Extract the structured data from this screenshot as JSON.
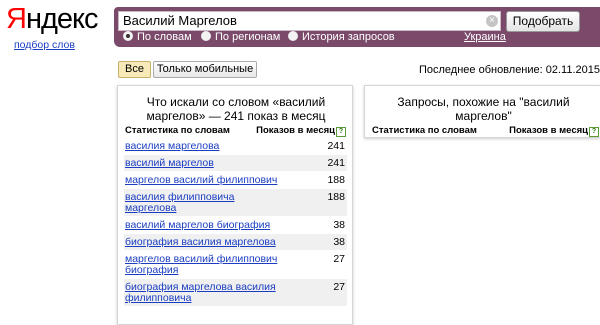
{
  "logo": {
    "first_letter": "Я",
    "rest": "ндекс"
  },
  "subtitle": "подбор слов",
  "search": {
    "value": "Василий Маргелов",
    "clear_icon": "×",
    "submit_label": "Подобрать"
  },
  "search_modes": [
    {
      "label": "По словам",
      "checked": true
    },
    {
      "label": "По регионам",
      "checked": false
    },
    {
      "label": "История запросов",
      "checked": false
    }
  ],
  "region": "Украина",
  "filters": {
    "all": "Все",
    "mobile": "Только мобильные"
  },
  "last_update": "Последнее обновление: 02.11.2015",
  "left_panel": {
    "title": "Что искали со словом «василий маргелов» — 241 показ в месяц",
    "col_words": "Статистика по словам",
    "col_views": "Показов в месяц",
    "rows": [
      {
        "phrase": "василия маргелова",
        "count": "241"
      },
      {
        "phrase": "василий маргелов",
        "count": "241"
      },
      {
        "phrase": "маргелов василий филиппович",
        "count": "188"
      },
      {
        "phrase": "василия филипповича маргелова",
        "count": "188"
      },
      {
        "phrase": "василий маргелов биография",
        "count": "38"
      },
      {
        "phrase": "биография василия маргелова",
        "count": "38"
      },
      {
        "phrase": "маргелов василий филиппович биография",
        "count": "27"
      },
      {
        "phrase": "биография маргелова василия филипповича",
        "count": "27"
      }
    ]
  },
  "right_panel": {
    "title": "Запросы, похожие на \"василий маргелов\"",
    "col_words": "Статистика по словам",
    "col_views": "Показов в месяц"
  },
  "help_icon_glyph": "?",
  "colors": {
    "header_band": "#7b4a6a",
    "link": "#1a3dc1",
    "logo_red": "#ff0000",
    "active_tab": "#f7e9b8"
  }
}
